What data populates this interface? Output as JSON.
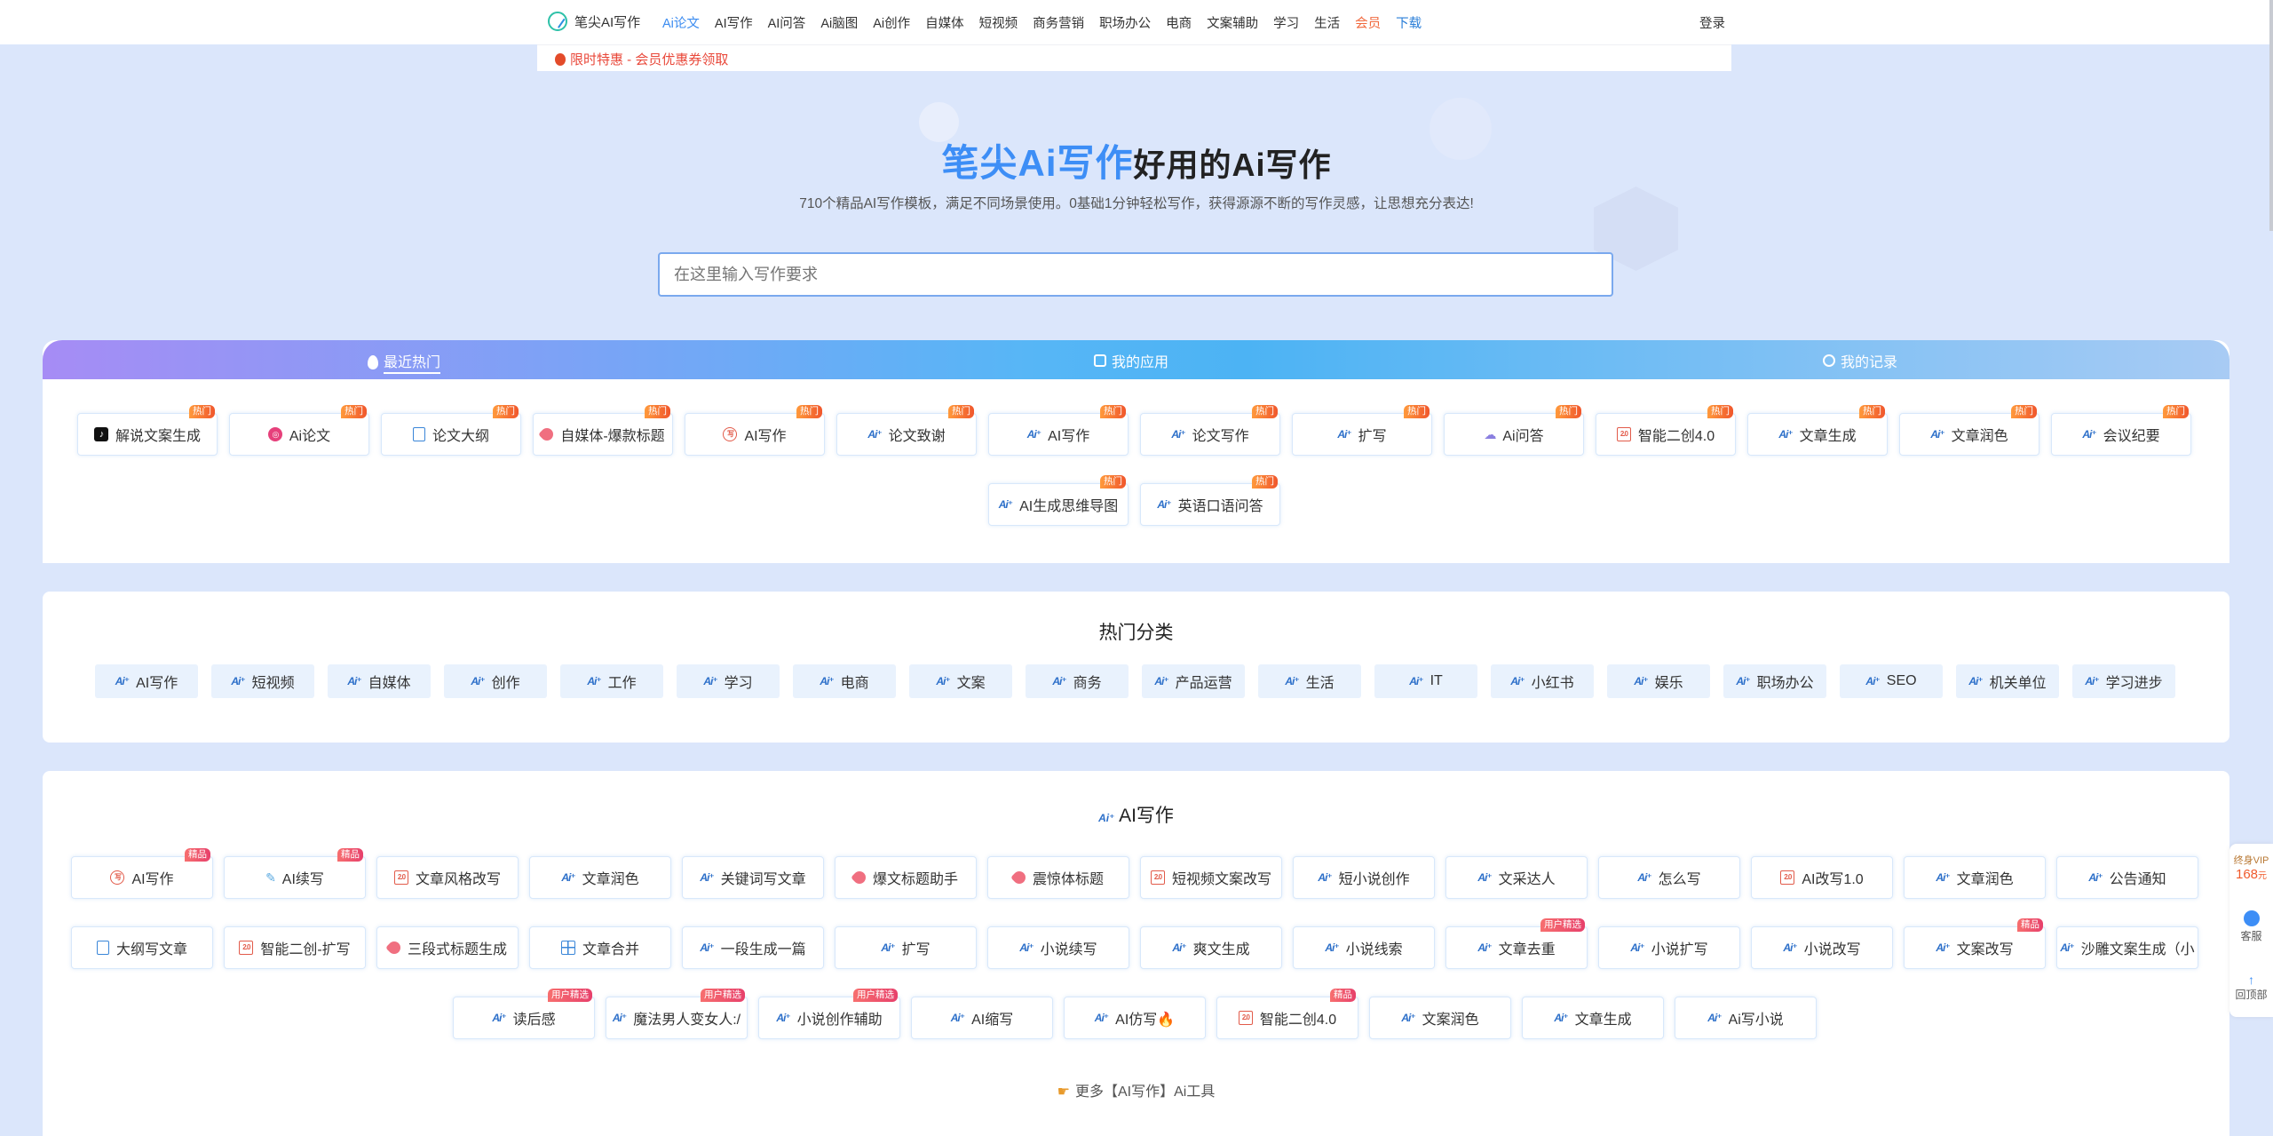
{
  "nav": {
    "logo_text": "笔尖AI写作",
    "items": [
      {
        "label": "Ai论文",
        "state": "active"
      },
      {
        "label": "AI写作"
      },
      {
        "label": "AI问答"
      },
      {
        "label": "Ai脑图"
      },
      {
        "label": "Ai创作"
      },
      {
        "label": "自媒体"
      },
      {
        "label": "短视频"
      },
      {
        "label": "商务营销"
      },
      {
        "label": "职场办公"
      },
      {
        "label": "电商"
      },
      {
        "label": "文案辅助"
      },
      {
        "label": "学习"
      },
      {
        "label": "生活"
      },
      {
        "label": "会员",
        "state": "vip",
        "badge": "限时特惠"
      },
      {
        "label": "下载",
        "state": "download"
      }
    ],
    "login": "登录"
  },
  "promo": {
    "text": "限时特惠 - 会员优惠券领取"
  },
  "hero": {
    "title_blue": "笔尖Ai写作",
    "title_dark": "好用的Ai写作",
    "subtitle": "710个精品AI写作模板，满足不同场景使用。0基础1分钟轻松写作，获得源源不断的写作灵感，让思想充分表达!"
  },
  "search": {
    "placeholder": "在这里输入写作要求"
  },
  "tabs": [
    {
      "label": "最近热门",
      "icon": "flame-icon"
    },
    {
      "label": "我的应用",
      "icon": "grid-icon"
    },
    {
      "label": "我的记录",
      "icon": "clock-icon"
    }
  ],
  "hot_items": [
    {
      "label": "解说文案生成",
      "icon": "tiktok-icon",
      "badge": "热门"
    },
    {
      "label": "Ai论文",
      "icon": "pink-circle-icon",
      "badge": "热门"
    },
    {
      "label": "论文大纲",
      "icon": "document-icon",
      "badge": "热门"
    },
    {
      "label": "自媒体-爆款标题",
      "icon": "tag-icon",
      "badge": "热门"
    },
    {
      "label": "AI写作",
      "icon": "ai-circle-icon",
      "badge": "热门"
    },
    {
      "label": "论文致谢",
      "icon": "ai-icon",
      "badge": "热门"
    },
    {
      "label": "AI写作",
      "icon": "ai-icon",
      "badge": "热门"
    },
    {
      "label": "论文写作",
      "icon": "ai-icon",
      "badge": "热门"
    },
    {
      "label": "扩写",
      "icon": "ai-icon",
      "badge": "热门"
    },
    {
      "label": "Ai问答",
      "icon": "cloud-icon",
      "badge": "热门"
    },
    {
      "label": "智能二创4.0",
      "icon": "square-icon",
      "badge": "热门"
    },
    {
      "label": "文章生成",
      "icon": "ai-icon",
      "badge": "热门"
    },
    {
      "label": "文章润色",
      "icon": "ai-icon",
      "badge": "热门"
    },
    {
      "label": "会议纪要",
      "icon": "ai-icon",
      "badge": "热门"
    },
    {
      "label": "AI生成思维导图",
      "icon": "ai-icon",
      "badge": "热门"
    },
    {
      "label": "英语口语问答",
      "icon": "ai-icon",
      "badge": "热门"
    }
  ],
  "categories": {
    "title": "热门分类",
    "items": [
      "AI写作",
      "短视频",
      "自媒体",
      "创作",
      "工作",
      "学习",
      "电商",
      "文案",
      "商务",
      "产品运营",
      "生活",
      "IT",
      "小红书",
      "娱乐",
      "职场办公",
      "SEO",
      "机关单位",
      "学习进步"
    ]
  },
  "ai_writing": {
    "title": "AI写作",
    "items": [
      {
        "label": "AI写作",
        "icon": "ai-circle-icon",
        "badge": "精品"
      },
      {
        "label": "AI续写",
        "icon": "pen-icon",
        "badge": "精品"
      },
      {
        "label": "文章风格改写",
        "icon": "square-icon"
      },
      {
        "label": "文章润色",
        "icon": "ai-icon"
      },
      {
        "label": "关键词写文章",
        "icon": "ai-icon"
      },
      {
        "label": "爆文标题助手",
        "icon": "tag-icon"
      },
      {
        "label": "震惊体标题",
        "icon": "tag-icon"
      },
      {
        "label": "短视频文案改写",
        "icon": "square-icon"
      },
      {
        "label": "短小说创作",
        "icon": "ai-icon"
      },
      {
        "label": "文采达人",
        "icon": "ai-icon"
      },
      {
        "label": "怎么写",
        "icon": "ai-icon"
      },
      {
        "label": "AI改写1.0",
        "icon": "square-icon"
      },
      {
        "label": "文章润色",
        "icon": "ai-icon"
      },
      {
        "label": "公告通知",
        "icon": "ai-icon"
      },
      {
        "label": "大纲写文章",
        "icon": "document-icon"
      },
      {
        "label": "智能二创-扩写",
        "icon": "square-icon"
      },
      {
        "label": "三段式标题生成",
        "icon": "tag-icon"
      },
      {
        "label": "文章合并",
        "icon": "grid-icon"
      },
      {
        "label": "一段生成一篇",
        "icon": "ai-icon"
      },
      {
        "label": "扩写",
        "icon": "ai-icon"
      },
      {
        "label": "小说续写",
        "icon": "ai-icon"
      },
      {
        "label": "爽文生成",
        "icon": "ai-icon"
      },
      {
        "label": "小说线索",
        "icon": "ai-icon"
      },
      {
        "label": "文章去重",
        "icon": "ai-icon",
        "badge": "用户精选"
      },
      {
        "label": "小说扩写",
        "icon": "ai-icon"
      },
      {
        "label": "小说改写",
        "icon": "ai-icon"
      },
      {
        "label": "文案改写",
        "icon": "ai-icon",
        "badge": "精品"
      },
      {
        "label": "沙雕文案生成（小",
        "icon": "ai-icon"
      },
      {
        "label": "读后感",
        "icon": "ai-icon",
        "badge": "用户精选"
      },
      {
        "label": "魔法男人变女人:/",
        "icon": "ai-icon",
        "badge": "用户精选"
      },
      {
        "label": "小说创作辅助",
        "icon": "ai-icon",
        "badge": "用户精选"
      },
      {
        "label": "AI缩写",
        "icon": "ai-icon"
      },
      {
        "label": "AI仿写🔥",
        "icon": "ai-icon"
      },
      {
        "label": "智能二创4.0",
        "icon": "square-icon",
        "badge": "精品"
      },
      {
        "label": "文案润色",
        "icon": "ai-icon"
      },
      {
        "label": "文章生成",
        "icon": "ai-icon"
      },
      {
        "label": "Ai写小说",
        "icon": "ai-icon"
      }
    ],
    "more": "更多【AI写作】Ai工具"
  },
  "sidebar": {
    "vip_label": "终身VIP",
    "vip_price": "168",
    "vip_unit": "元",
    "service": "客服",
    "top": "回顶部"
  },
  "colors": {
    "accent": "#3d8ef6",
    "hot_badge": "#f0562c",
    "page_bg": "#dbe6fb"
  }
}
